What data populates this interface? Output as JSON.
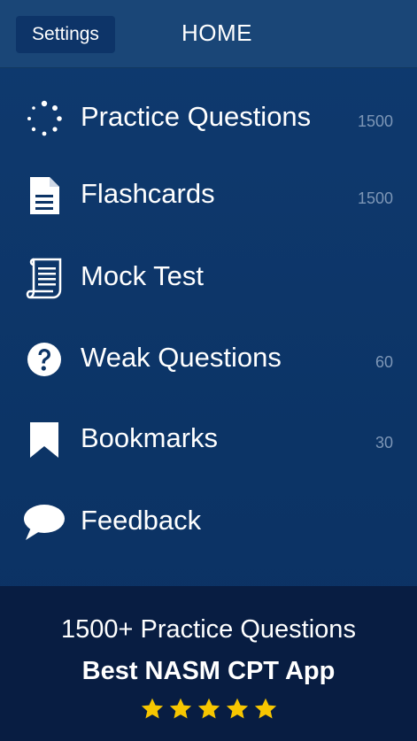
{
  "header": {
    "settings_label": "Settings",
    "title": "HOME"
  },
  "menu": {
    "items": [
      {
        "label": "Practice Questions",
        "count": "1500",
        "icon": "spinner-dots-icon"
      },
      {
        "label": "Flashcards",
        "count": "1500",
        "icon": "document-icon"
      },
      {
        "label": "Mock Test",
        "count": "",
        "icon": "scroll-icon"
      },
      {
        "label": "Weak Questions",
        "count": "60",
        "icon": "question-circle-icon"
      },
      {
        "label": "Bookmarks",
        "count": "30",
        "icon": "bookmark-icon"
      },
      {
        "label": "Feedback",
        "count": "",
        "icon": "speech-bubble-icon"
      }
    ]
  },
  "banner": {
    "line1": "1500+ Practice Questions",
    "line2": "Best NASM CPT App",
    "rating": 5
  },
  "colors": {
    "background": "#0c3466",
    "navbar": "#1a4677",
    "banner": "#081d42",
    "count_text": "#7d96b6",
    "star": "#f7c600"
  }
}
